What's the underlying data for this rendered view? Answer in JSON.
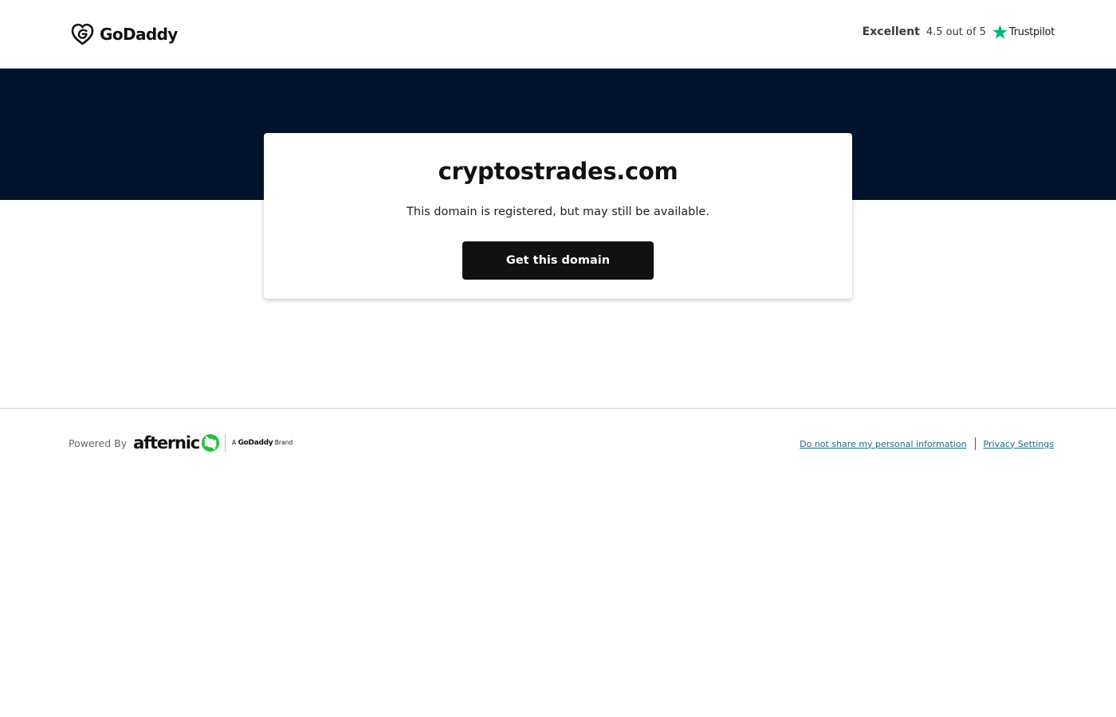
{
  "header": {
    "logo_text": "GoDaddy",
    "trustpilot": {
      "rating_word": "Excellent",
      "score": "4.5 out of 5",
      "brand": "Trustpilot",
      "star_color": "#00b67a"
    }
  },
  "colors": {
    "hero_background": "#01132c",
    "button_background": "#111111",
    "link": "#1d6a8b",
    "afternic_green": "#1fc23e"
  },
  "card": {
    "domain": "cryptostrades.com",
    "status": "This domain is registered, but may still be available.",
    "cta_label": "Get this domain"
  },
  "footer": {
    "powered_by": "Powered By",
    "brand_word": "afternic",
    "godaddy_brand_prefix": "A",
    "godaddy_brand_name": "GoDaddy",
    "godaddy_brand_suffix": "Brand",
    "links": [
      {
        "label": "Do not share my personal information"
      },
      {
        "label": "Privacy Settings"
      }
    ]
  }
}
